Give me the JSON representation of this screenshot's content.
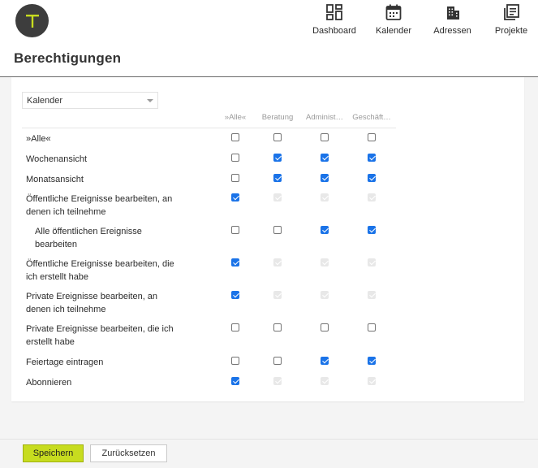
{
  "logo": {
    "letter": "T",
    "colors": {
      "circle": "#3d3d3d",
      "letter": "#c7dc1f"
    }
  },
  "nav": [
    {
      "label": "Dashboard",
      "icon": "dashboard-icon"
    },
    {
      "label": "Kalender",
      "icon": "calendar-icon"
    },
    {
      "label": "Adressen",
      "icon": "buildings-icon"
    },
    {
      "label": "Projekte",
      "icon": "documents-icon"
    }
  ],
  "page": {
    "title": "Berechtigungen"
  },
  "module_select": {
    "value": "Kalender"
  },
  "columns": [
    "»Alle«",
    "Beratung",
    "Administ…",
    "Geschäft…"
  ],
  "rows": [
    {
      "label": [
        "»Alle«"
      ],
      "states": [
        "off",
        "off",
        "off",
        "off"
      ]
    },
    {
      "label": [
        "Wochenansicht"
      ],
      "states": [
        "off",
        "on",
        "on",
        "on"
      ]
    },
    {
      "label": [
        "Monatsansicht"
      ],
      "states": [
        "off",
        "on",
        "on",
        "on"
      ]
    },
    {
      "label": [
        "Öffentliche Ereignisse bearbeiten, an",
        "denen ich teilnehme"
      ],
      "states": [
        "on",
        "disabled",
        "disabled",
        "disabled"
      ]
    },
    {
      "label": [
        "Alle öffentlichen Ereignisse",
        "bearbeiten"
      ],
      "indent": true,
      "states": [
        "off",
        "off",
        "on",
        "on"
      ]
    },
    {
      "label": [
        "Öffentliche Ereignisse bearbeiten, die",
        "ich erstellt habe"
      ],
      "states": [
        "on",
        "disabled",
        "disabled",
        "disabled"
      ]
    },
    {
      "label": [
        "Private Ereignisse bearbeiten, an",
        "denen ich teilnehme"
      ],
      "states": [
        "on",
        "disabled",
        "disabled",
        "disabled"
      ]
    },
    {
      "label": [
        "Private Ereignisse bearbeiten, die ich",
        "erstellt habe"
      ],
      "states": [
        "off",
        "off",
        "off",
        "off"
      ]
    },
    {
      "label": [
        "Feiertage eintragen"
      ],
      "states": [
        "off",
        "off",
        "on",
        "on"
      ]
    },
    {
      "label": [
        "Abonnieren"
      ],
      "states": [
        "on",
        "disabled",
        "disabled",
        "disabled"
      ]
    }
  ],
  "footer": {
    "save_label": "Speichern",
    "reset_label": "Zurücksetzen"
  },
  "colors": {
    "accent": "#c7dc1f",
    "checkbox": "#1a73e8",
    "background": "#f4f4f4"
  }
}
